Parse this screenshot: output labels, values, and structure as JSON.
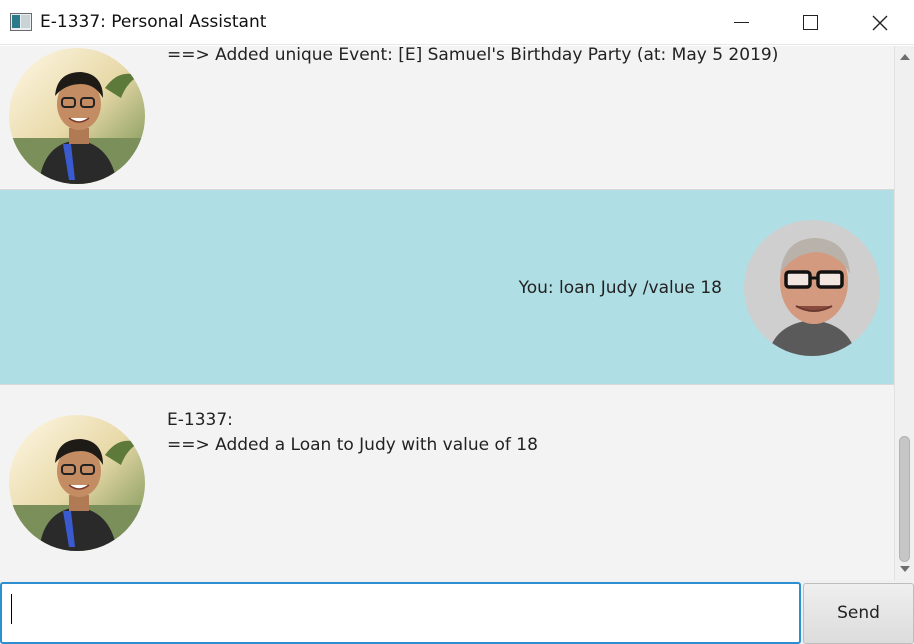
{
  "window": {
    "title": "E-1337: Personal Assistant",
    "icon": "app-window-icon",
    "controls": [
      "minimize-icon",
      "maximize-icon",
      "close-icon"
    ]
  },
  "dialogs": [
    {
      "speaker": "bot",
      "avatar": "bot-avatar",
      "text": "==> Added unique Event: [E] Samuel's Birthday Party (at: May 5 2019)",
      "background": "#f3f3f3"
    },
    {
      "speaker": "user",
      "avatar": "user-avatar",
      "text": "You: loan Judy /value 18",
      "background": "#afdee4"
    },
    {
      "speaker": "bot",
      "avatar": "bot-avatar",
      "text": "E-1337:\n==> Added a Loan to Judy with value of 18",
      "background": "#f3f3f3"
    }
  ],
  "input": {
    "value": "",
    "focus_color": "#2d8fd1"
  },
  "send_label": "Send"
}
